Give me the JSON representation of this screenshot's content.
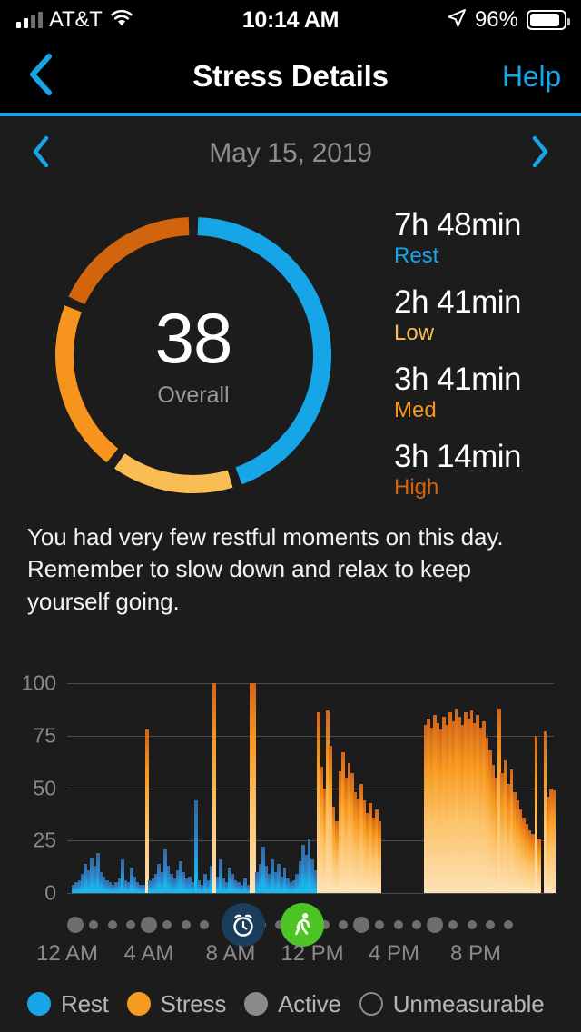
{
  "status_bar": {
    "carrier": "AT&T",
    "time": "10:14 AM",
    "battery_percent": "96%",
    "signal_icon": "signal-bars-icon",
    "wifi_icon": "wifi-icon",
    "location_icon": "location-arrow-icon",
    "battery_icon": "battery-icon",
    "battery_level": 0.9
  },
  "nav": {
    "back_icon": "chevron-left-icon",
    "title": "Stress Details",
    "help_label": "Help",
    "accent_color": "#16a6e8"
  },
  "date_nav": {
    "prev_icon": "chevron-left-icon",
    "next_icon": "chevron-right-icon",
    "date": "May 15, 2019"
  },
  "summary": {
    "score": "38",
    "score_label": "Overall",
    "stats": [
      {
        "value": "7h 48min",
        "label": "Rest",
        "color": "#16a6e8",
        "hours": 7.8
      },
      {
        "value": "2h 41min",
        "label": "Low",
        "color": "#f9bd54",
        "hours": 2.683
      },
      {
        "value": "3h 41min",
        "label": "Med",
        "color": "#f7941d",
        "hours": 3.683
      },
      {
        "value": "3h 14min",
        "label": "High",
        "color": "#d2640d",
        "hours": 3.233
      }
    ]
  },
  "description": "You had very few restful moments on this day. Remember to slow down and relax to keep yourself going.",
  "chart_data": {
    "type": "bar",
    "title": "",
    "xlabel": "",
    "ylabel": "",
    "ylim": [
      0,
      100
    ],
    "yticks": [
      0,
      25,
      50,
      75,
      100
    ],
    "ytick_labels": [
      "0",
      "25",
      "50",
      "75",
      "100"
    ],
    "grid": true,
    "legend_position": "bottom",
    "x_range_hours": [
      0,
      24
    ],
    "xticks": [
      0,
      4,
      8,
      12,
      16,
      20
    ],
    "xtick_labels": [
      "12 AM",
      "4 AM",
      "8 AM",
      "12 PM",
      "4 PM",
      "8 PM"
    ],
    "series": [
      {
        "name": "Rest",
        "color": "#19b9f0"
      },
      {
        "name": "Stress",
        "color": "#f79a20"
      }
    ],
    "bars": [
      {
        "h": 0.3,
        "v": 4,
        "t": "rest"
      },
      {
        "h": 0.45,
        "v": 5,
        "t": "rest"
      },
      {
        "h": 0.6,
        "v": 6,
        "t": "rest"
      },
      {
        "h": 0.75,
        "v": 9,
        "t": "rest"
      },
      {
        "h": 0.9,
        "v": 14,
        "t": "rest"
      },
      {
        "h": 1.05,
        "v": 11,
        "t": "rest"
      },
      {
        "h": 1.2,
        "v": 17,
        "t": "rest"
      },
      {
        "h": 1.35,
        "v": 13,
        "t": "rest"
      },
      {
        "h": 1.5,
        "v": 19,
        "t": "rest"
      },
      {
        "h": 1.65,
        "v": 10,
        "t": "rest"
      },
      {
        "h": 1.8,
        "v": 8,
        "t": "rest"
      },
      {
        "h": 1.95,
        "v": 6,
        "t": "rest"
      },
      {
        "h": 2.1,
        "v": 5,
        "t": "rest"
      },
      {
        "h": 2.25,
        "v": 4,
        "t": "rest"
      },
      {
        "h": 2.4,
        "v": 5,
        "t": "rest"
      },
      {
        "h": 2.55,
        "v": 7,
        "t": "rest"
      },
      {
        "h": 2.7,
        "v": 16,
        "t": "rest"
      },
      {
        "h": 2.85,
        "v": 6,
        "t": "rest"
      },
      {
        "h": 3.0,
        "v": 5,
        "t": "rest"
      },
      {
        "h": 3.15,
        "v": 12,
        "t": "rest"
      },
      {
        "h": 3.3,
        "v": 8,
        "t": "rest"
      },
      {
        "h": 3.45,
        "v": 5,
        "t": "rest"
      },
      {
        "h": 3.6,
        "v": 4,
        "t": "rest"
      },
      {
        "h": 3.75,
        "v": 4,
        "t": "rest"
      },
      {
        "h": 3.9,
        "v": 78,
        "t": "stress"
      },
      {
        "h": 4.05,
        "v": 6,
        "t": "rest"
      },
      {
        "h": 4.2,
        "v": 7,
        "t": "rest"
      },
      {
        "h": 4.35,
        "v": 9,
        "t": "rest"
      },
      {
        "h": 4.5,
        "v": 14,
        "t": "rest"
      },
      {
        "h": 4.65,
        "v": 10,
        "t": "rest"
      },
      {
        "h": 4.8,
        "v": 21,
        "t": "rest"
      },
      {
        "h": 4.95,
        "v": 13,
        "t": "rest"
      },
      {
        "h": 5.1,
        "v": 9,
        "t": "rest"
      },
      {
        "h": 5.25,
        "v": 7,
        "t": "rest"
      },
      {
        "h": 5.4,
        "v": 11,
        "t": "rest"
      },
      {
        "h": 5.55,
        "v": 15,
        "t": "rest"
      },
      {
        "h": 5.7,
        "v": 10,
        "t": "rest"
      },
      {
        "h": 5.85,
        "v": 7,
        "t": "rest"
      },
      {
        "h": 6.0,
        "v": 8,
        "t": "rest"
      },
      {
        "h": 6.15,
        "v": 5,
        "t": "rest"
      },
      {
        "h": 6.3,
        "v": 44,
        "t": "rest"
      },
      {
        "h": 6.45,
        "v": 6,
        "t": "rest"
      },
      {
        "h": 6.6,
        "v": 4,
        "t": "rest"
      },
      {
        "h": 6.75,
        "v": 9,
        "t": "rest"
      },
      {
        "h": 6.9,
        "v": 6,
        "t": "rest"
      },
      {
        "h": 7.05,
        "v": 13,
        "t": "rest"
      },
      {
        "h": 7.2,
        "v": 100,
        "t": "stress"
      },
      {
        "h": 7.35,
        "v": 8,
        "t": "rest"
      },
      {
        "h": 7.5,
        "v": 16,
        "t": "rest"
      },
      {
        "h": 7.65,
        "v": 7,
        "t": "rest"
      },
      {
        "h": 7.8,
        "v": 5,
        "t": "rest"
      },
      {
        "h": 7.95,
        "v": 12,
        "t": "rest"
      },
      {
        "h": 8.1,
        "v": 9,
        "t": "rest"
      },
      {
        "h": 8.25,
        "v": 6,
        "t": "rest"
      },
      {
        "h": 8.4,
        "v": 5,
        "t": "rest"
      },
      {
        "h": 8.55,
        "v": 4,
        "t": "rest"
      },
      {
        "h": 8.7,
        "v": 7,
        "t": "rest"
      },
      {
        "h": 8.85,
        "v": 4,
        "t": "rest"
      },
      {
        "h": 9.0,
        "v": 100,
        "t": "stress"
      },
      {
        "h": 9.15,
        "v": 100,
        "t": "stress"
      },
      {
        "h": 9.3,
        "v": 10,
        "t": "rest"
      },
      {
        "h": 9.45,
        "v": 14,
        "t": "rest"
      },
      {
        "h": 9.6,
        "v": 22,
        "t": "rest"
      },
      {
        "h": 9.75,
        "v": 13,
        "t": "rest"
      },
      {
        "h": 9.9,
        "v": 9,
        "t": "rest"
      },
      {
        "h": 10.05,
        "v": 16,
        "t": "rest"
      },
      {
        "h": 10.2,
        "v": 10,
        "t": "rest"
      },
      {
        "h": 10.35,
        "v": 14,
        "t": "rest"
      },
      {
        "h": 10.5,
        "v": 8,
        "t": "rest"
      },
      {
        "h": 10.65,
        "v": 12,
        "t": "rest"
      },
      {
        "h": 10.8,
        "v": 7,
        "t": "rest"
      },
      {
        "h": 10.95,
        "v": 5,
        "t": "rest"
      },
      {
        "h": 11.1,
        "v": 6,
        "t": "rest"
      },
      {
        "h": 11.25,
        "v": 9,
        "t": "rest"
      },
      {
        "h": 11.4,
        "v": 15,
        "t": "rest"
      },
      {
        "h": 11.55,
        "v": 23,
        "t": "rest"
      },
      {
        "h": 11.7,
        "v": 18,
        "t": "rest"
      },
      {
        "h": 11.85,
        "v": 26,
        "t": "rest"
      },
      {
        "h": 12.0,
        "v": 16,
        "t": "rest"
      },
      {
        "h": 12.15,
        "v": 11,
        "t": "rest"
      },
      {
        "h": 12.3,
        "v": 86,
        "t": "stress"
      },
      {
        "h": 12.45,
        "v": 60,
        "t": "stress"
      },
      {
        "h": 12.6,
        "v": 50,
        "t": "stress"
      },
      {
        "h": 12.75,
        "v": 87,
        "t": "stress"
      },
      {
        "h": 12.9,
        "v": 70,
        "t": "stress"
      },
      {
        "h": 13.05,
        "v": 41,
        "t": "stress"
      },
      {
        "h": 13.2,
        "v": 34,
        "t": "stress"
      },
      {
        "h": 13.35,
        "v": 58,
        "t": "stress"
      },
      {
        "h": 13.5,
        "v": 67,
        "t": "stress"
      },
      {
        "h": 13.65,
        "v": 55,
        "t": "stress"
      },
      {
        "h": 13.8,
        "v": 62,
        "t": "stress"
      },
      {
        "h": 13.95,
        "v": 57,
        "t": "stress"
      },
      {
        "h": 14.1,
        "v": 48,
        "t": "stress"
      },
      {
        "h": 14.25,
        "v": 45,
        "t": "stress"
      },
      {
        "h": 14.4,
        "v": 52,
        "t": "stress"
      },
      {
        "h": 14.55,
        "v": 44,
        "t": "stress"
      },
      {
        "h": 14.7,
        "v": 38,
        "t": "stress"
      },
      {
        "h": 14.85,
        "v": 43,
        "t": "stress"
      },
      {
        "h": 15.0,
        "v": 36,
        "t": "stress"
      },
      {
        "h": 15.15,
        "v": 40,
        "t": "stress"
      },
      {
        "h": 15.3,
        "v": 34,
        "t": "stress"
      },
      {
        "h": 17.55,
        "v": 80,
        "t": "stress"
      },
      {
        "h": 17.7,
        "v": 83,
        "t": "stress"
      },
      {
        "h": 17.85,
        "v": 79,
        "t": "stress"
      },
      {
        "h": 18.0,
        "v": 85,
        "t": "stress"
      },
      {
        "h": 18.15,
        "v": 81,
        "t": "stress"
      },
      {
        "h": 18.3,
        "v": 78,
        "t": "stress"
      },
      {
        "h": 18.45,
        "v": 84,
        "t": "stress"
      },
      {
        "h": 18.6,
        "v": 80,
        "t": "stress"
      },
      {
        "h": 18.75,
        "v": 86,
        "t": "stress"
      },
      {
        "h": 18.9,
        "v": 82,
        "t": "stress"
      },
      {
        "h": 19.05,
        "v": 88,
        "t": "stress"
      },
      {
        "h": 19.2,
        "v": 84,
        "t": "stress"
      },
      {
        "h": 19.35,
        "v": 80,
        "t": "stress"
      },
      {
        "h": 19.5,
        "v": 86,
        "t": "stress"
      },
      {
        "h": 19.65,
        "v": 83,
        "t": "stress"
      },
      {
        "h": 19.8,
        "v": 87,
        "t": "stress"
      },
      {
        "h": 19.95,
        "v": 81,
        "t": "stress"
      },
      {
        "h": 20.1,
        "v": 85,
        "t": "stress"
      },
      {
        "h": 20.25,
        "v": 79,
        "t": "stress"
      },
      {
        "h": 20.4,
        "v": 82,
        "t": "stress"
      },
      {
        "h": 20.55,
        "v": 74,
        "t": "stress"
      },
      {
        "h": 20.7,
        "v": 68,
        "t": "stress"
      },
      {
        "h": 20.85,
        "v": 61,
        "t": "stress"
      },
      {
        "h": 21.0,
        "v": 55,
        "t": "stress"
      },
      {
        "h": 21.15,
        "v": 88,
        "t": "stress"
      },
      {
        "h": 21.3,
        "v": 57,
        "t": "stress"
      },
      {
        "h": 21.45,
        "v": 63,
        "t": "stress"
      },
      {
        "h": 21.6,
        "v": 52,
        "t": "stress"
      },
      {
        "h": 21.75,
        "v": 59,
        "t": "stress"
      },
      {
        "h": 21.9,
        "v": 48,
        "t": "stress"
      },
      {
        "h": 22.05,
        "v": 44,
        "t": "stress"
      },
      {
        "h": 22.2,
        "v": 40,
        "t": "stress"
      },
      {
        "h": 22.35,
        "v": 36,
        "t": "stress"
      },
      {
        "h": 22.5,
        "v": 33,
        "t": "stress"
      },
      {
        "h": 22.65,
        "v": 30,
        "t": "stress"
      },
      {
        "h": 22.8,
        "v": 28,
        "t": "stress"
      },
      {
        "h": 22.95,
        "v": 75,
        "t": "stress"
      },
      {
        "h": 23.1,
        "v": 26,
        "t": "stress"
      },
      {
        "h": 23.4,
        "v": 77,
        "t": "stress"
      },
      {
        "h": 23.55,
        "v": 46,
        "t": "stress"
      },
      {
        "h": 23.7,
        "v": 50,
        "t": "stress"
      },
      {
        "h": 23.85,
        "v": 49,
        "t": "stress"
      }
    ],
    "markers": [
      {
        "hour": 8.6,
        "type": "sleep",
        "icon": "alarm-clock-icon",
        "color": "#1a3d5c"
      },
      {
        "hour": 11.5,
        "type": "activity",
        "icon": "running-person-icon",
        "color": "#4cc425"
      }
    ],
    "timeline_dots": [
      {
        "hour": 0.4,
        "size": "md"
      },
      {
        "hour": 1.3,
        "size": "sm"
      },
      {
        "hour": 2.2,
        "size": "sm"
      },
      {
        "hour": 3.1,
        "size": "sm"
      },
      {
        "hour": 4.0,
        "size": "md"
      },
      {
        "hour": 4.9,
        "size": "sm"
      },
      {
        "hour": 5.8,
        "size": "sm"
      },
      {
        "hour": 6.7,
        "size": "sm"
      },
      {
        "hour": 9.5,
        "size": "sm"
      },
      {
        "hour": 10.4,
        "size": "sm"
      },
      {
        "hour": 12.6,
        "size": "sm"
      },
      {
        "hour": 13.5,
        "size": "sm"
      },
      {
        "hour": 14.4,
        "size": "md"
      },
      {
        "hour": 15.3,
        "size": "sm"
      },
      {
        "hour": 16.2,
        "size": "sm"
      },
      {
        "hour": 17.1,
        "size": "sm"
      },
      {
        "hour": 18.0,
        "size": "md"
      },
      {
        "hour": 18.9,
        "size": "sm"
      },
      {
        "hour": 19.8,
        "size": "sm"
      },
      {
        "hour": 20.7,
        "size": "sm"
      },
      {
        "hour": 21.6,
        "size": "sm"
      }
    ]
  },
  "legend": [
    {
      "label": "Rest",
      "color": "#16a6e8",
      "style": "filled"
    },
    {
      "label": "Stress",
      "color": "#f79a20",
      "style": "filled"
    },
    {
      "label": "Active",
      "color": "#8a8a8a",
      "style": "filled"
    },
    {
      "label": "Unmeasurable",
      "color": "#8a8a8a",
      "style": "hollow"
    }
  ]
}
